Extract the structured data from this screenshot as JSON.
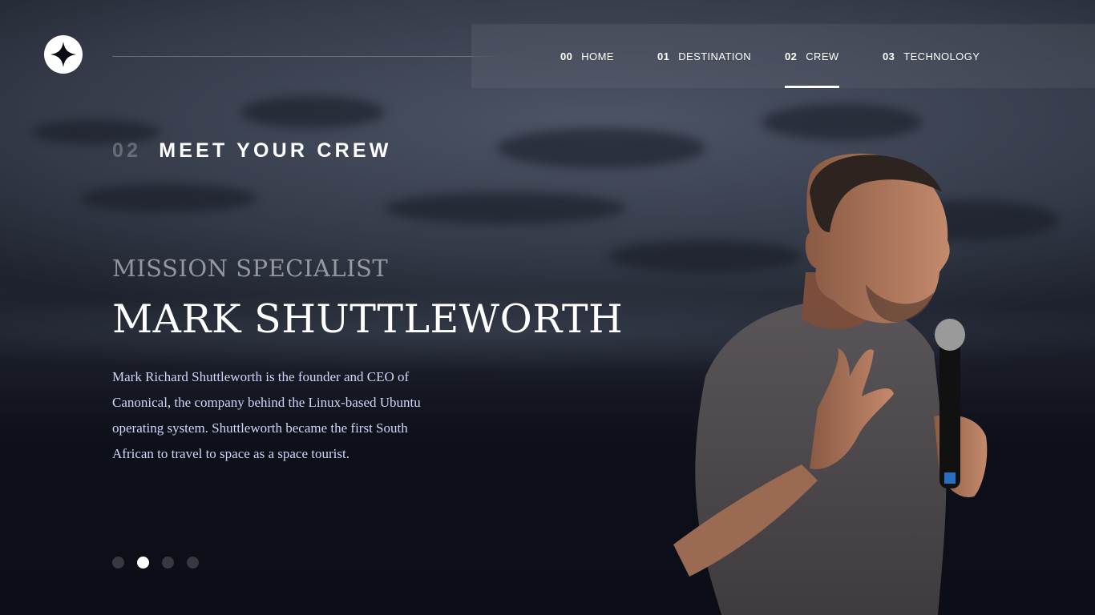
{
  "header": {
    "logo_icon": "star-icon",
    "nav": [
      {
        "num": "00",
        "label": "HOME",
        "active": false
      },
      {
        "num": "01",
        "label": "DESTINATION",
        "active": false
      },
      {
        "num": "02",
        "label": "CREW",
        "active": true
      },
      {
        "num": "03",
        "label": "TECHNOLOGY",
        "active": false
      }
    ]
  },
  "heading": {
    "num": "02",
    "label": "MEET YOUR CREW"
  },
  "crew": {
    "role": "MISSION SPECIALIST",
    "name": "MARK SHUTTLEWORTH",
    "bio": "Mark Richard Shuttleworth is the founder and CEO of Canonical, the company behind the Linux-based Ubuntu operating system. Shuttleworth became the first South African to travel to space as a space tourist."
  },
  "carousel": {
    "count": 4,
    "active_index": 1
  },
  "colors": {
    "background": "#0b0d17",
    "accent_text": "#d0d6f9",
    "white": "#ffffff"
  }
}
